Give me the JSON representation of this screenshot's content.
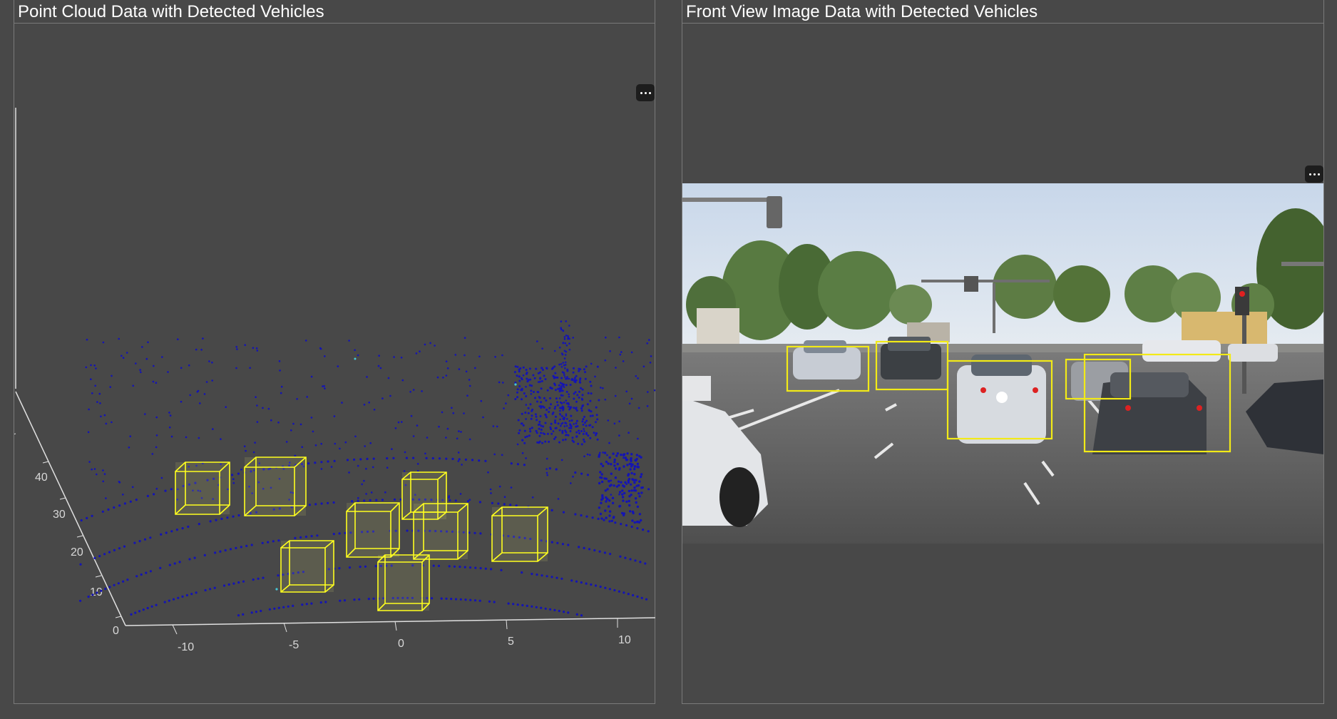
{
  "left_panel": {
    "title": "Point Cloud Data with Detected Vehicles",
    "axes": {
      "x_ticks": [
        "-10",
        "-5",
        "0",
        "5",
        "10"
      ],
      "y_ticks": [
        "0",
        "10",
        "20",
        "30",
        "40"
      ]
    },
    "colors": {
      "points": "#1414b4",
      "boxes": "#ffff1e",
      "axis": "#e0e0e0"
    },
    "menu_icon": "ellipsis-icon"
  },
  "right_panel": {
    "title": "Front View Image Data with Detected Vehicles",
    "detections_color": "#f2ea17",
    "menu_icon": "ellipsis-icon"
  }
}
